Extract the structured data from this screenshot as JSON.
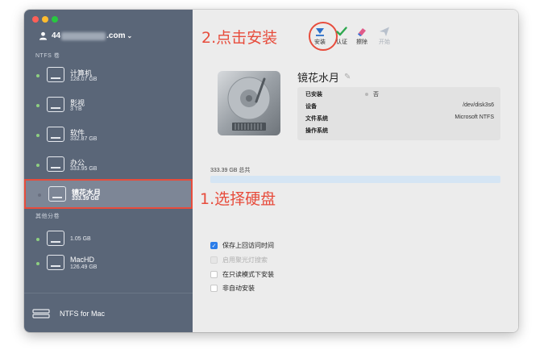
{
  "account": {
    "prefix": "44",
    "suffix": ".com",
    "chevron": "⌄"
  },
  "sidebar": {
    "section_ntfs": "NTFS 卷",
    "section_other": "其他分卷",
    "volumes": [
      {
        "name": "计算机",
        "size": "128.07 GB"
      },
      {
        "name": "影视",
        "size": "3 TB"
      },
      {
        "name": "软件",
        "size": "332.87 GB"
      },
      {
        "name": "办公",
        "size": "333.95 GB"
      },
      {
        "name": "镜花水月",
        "size": "333.39 GB"
      }
    ],
    "other_volumes": [
      {
        "name": "",
        "size": "1.05 GB"
      },
      {
        "name": "MacHD",
        "size": "126.49 GB"
      }
    ],
    "brand": "NTFS for Mac"
  },
  "toolbar": {
    "install": "安装",
    "verify": "认证",
    "erase": "擦除",
    "open": "开始"
  },
  "annotations": {
    "step2": "2.点击安装",
    "step1": "1.选择硬盘"
  },
  "detail": {
    "title": "镜花水月",
    "rows": [
      {
        "key": "已安装",
        "value": "否"
      },
      {
        "key": "设备",
        "value": "/dev/disk3s6"
      },
      {
        "key": "文件系统",
        "value": "Microsoft NTFS"
      },
      {
        "key": "操作系统",
        "value": ""
      }
    ],
    "total": "333.39 GB 总共",
    "usage_fraction": 0.0,
    "options": [
      {
        "label": "保存上回访问时间",
        "checked": true,
        "disabled": false
      },
      {
        "label": "启用聚光灯搜索",
        "checked": false,
        "disabled": true
      },
      {
        "label": "在只读模式下安装",
        "checked": false,
        "disabled": false
      },
      {
        "label": "非自动安装",
        "checked": false,
        "disabled": false
      }
    ]
  },
  "colors": {
    "sidebar": "#5a6678",
    "selected": "#7d8696",
    "annotation": "#e74c3c",
    "checkbox": "#2b7de9",
    "bar": "#d5e5f4"
  }
}
